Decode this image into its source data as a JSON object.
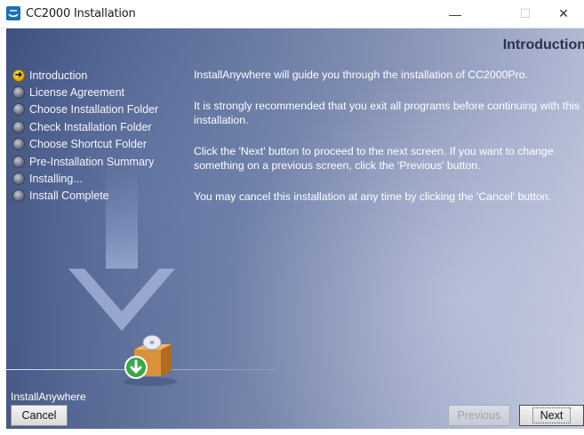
{
  "window": {
    "title": "CC2000 Installation",
    "icon": "cc2000-app-icon",
    "controls": {
      "minimize": "—",
      "maximize": "☐",
      "close": "✕"
    }
  },
  "header": {
    "title": "Introduction"
  },
  "steps": [
    {
      "label": "Introduction",
      "state": "current"
    },
    {
      "label": "License Agreement",
      "state": "pending"
    },
    {
      "label": "Choose Installation Folder",
      "state": "pending"
    },
    {
      "label": "Check Installation Folder",
      "state": "pending"
    },
    {
      "label": "Choose Shortcut Folder",
      "state": "pending"
    },
    {
      "label": "Pre-Installation Summary",
      "state": "pending"
    },
    {
      "label": "Installing...",
      "state": "pending"
    },
    {
      "label": "Install Complete",
      "state": "pending"
    }
  ],
  "content": {
    "paragraphs": [
      "InstallAnywhere will guide you through the installation of CC2000Pro.",
      "It is strongly recommended that you exit all programs before continuing with this installation.",
      "Click the 'Next' button to proceed to the next screen. If you want to change something on a previous screen, click the 'Previous' button.",
      "You may cancel this installation at any time by clicking the 'Cancel' button."
    ]
  },
  "footer": {
    "brand": "InstallAnywhere",
    "cancel_label": "Cancel",
    "previous_label": "Previous",
    "next_label": "Next",
    "previous_enabled": false
  },
  "colors": {
    "background_dark": "#3c4f7d",
    "background_light": "#c3c9dc",
    "current_step": "#e0a400",
    "heading": "#2e3147"
  }
}
